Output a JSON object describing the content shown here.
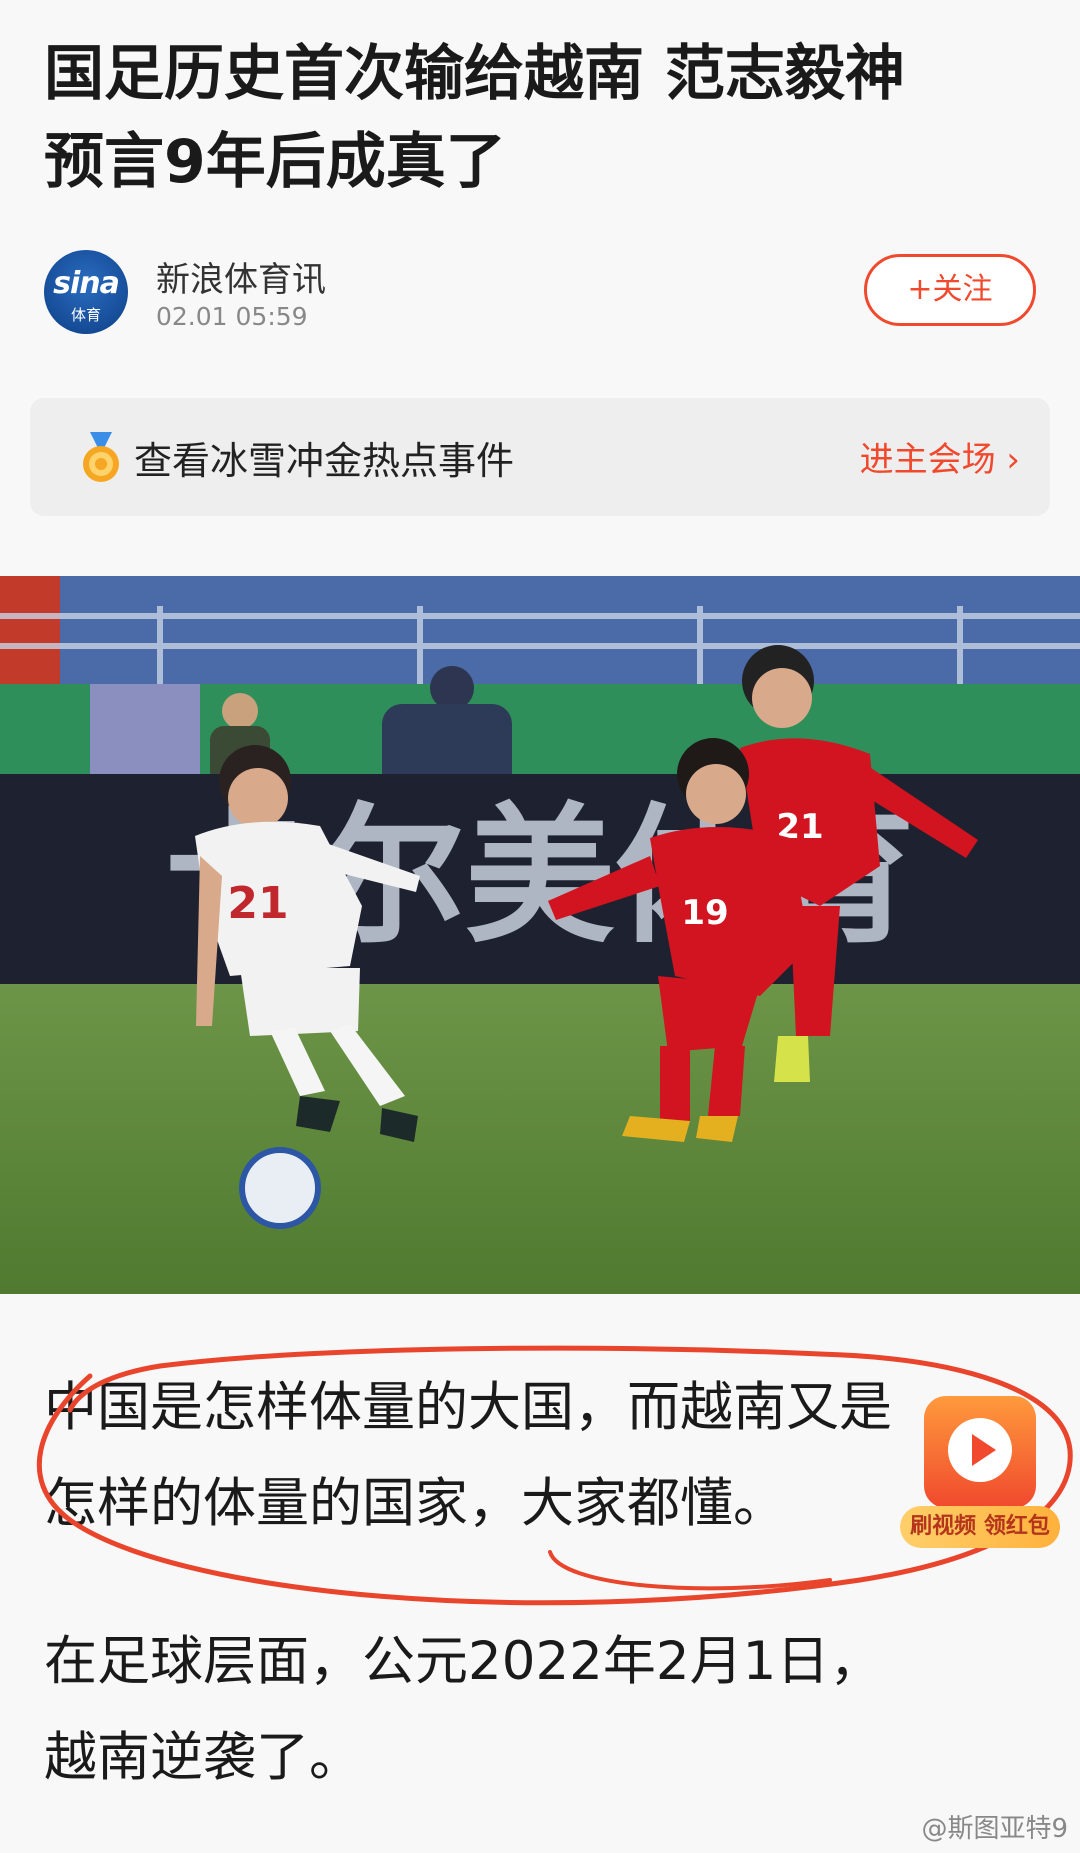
{
  "article": {
    "title_line1": "国足历史首次输给越南 范志毅神",
    "title_line2": "预言9年后成真了"
  },
  "author": {
    "avatar_brand": "sina",
    "avatar_sub": "体育",
    "name": "新浪体育讯",
    "time": "02.01  05:59",
    "follow_label": "+关注"
  },
  "banner": {
    "icon": "medal-icon",
    "text": "查看冰雪冲金热点事件",
    "link": "进主会场 ›"
  },
  "photo": {
    "ad_text": "卡尔美体育",
    "home_number": "21",
    "away_numbers": [
      "19",
      "21"
    ]
  },
  "body": {
    "para1_line1": "中国是怎样体量的大国，而越南又是",
    "para1_line2": "怎样的体量的国家，大家都懂。",
    "para2_line1": "在足球层面，公元2022年2月1日，",
    "para2_line2": "越南逆袭了。"
  },
  "float_button": {
    "icon": "play-icon",
    "label": "刷视频 领红包"
  },
  "watermark": "@斯图亚特9",
  "colors": {
    "accent": "#f0492e",
    "annotation": "#e8452c",
    "home_kit": "#f2f2f2",
    "away_kit": "#d1141f",
    "pitch": "#5f8a3c"
  }
}
